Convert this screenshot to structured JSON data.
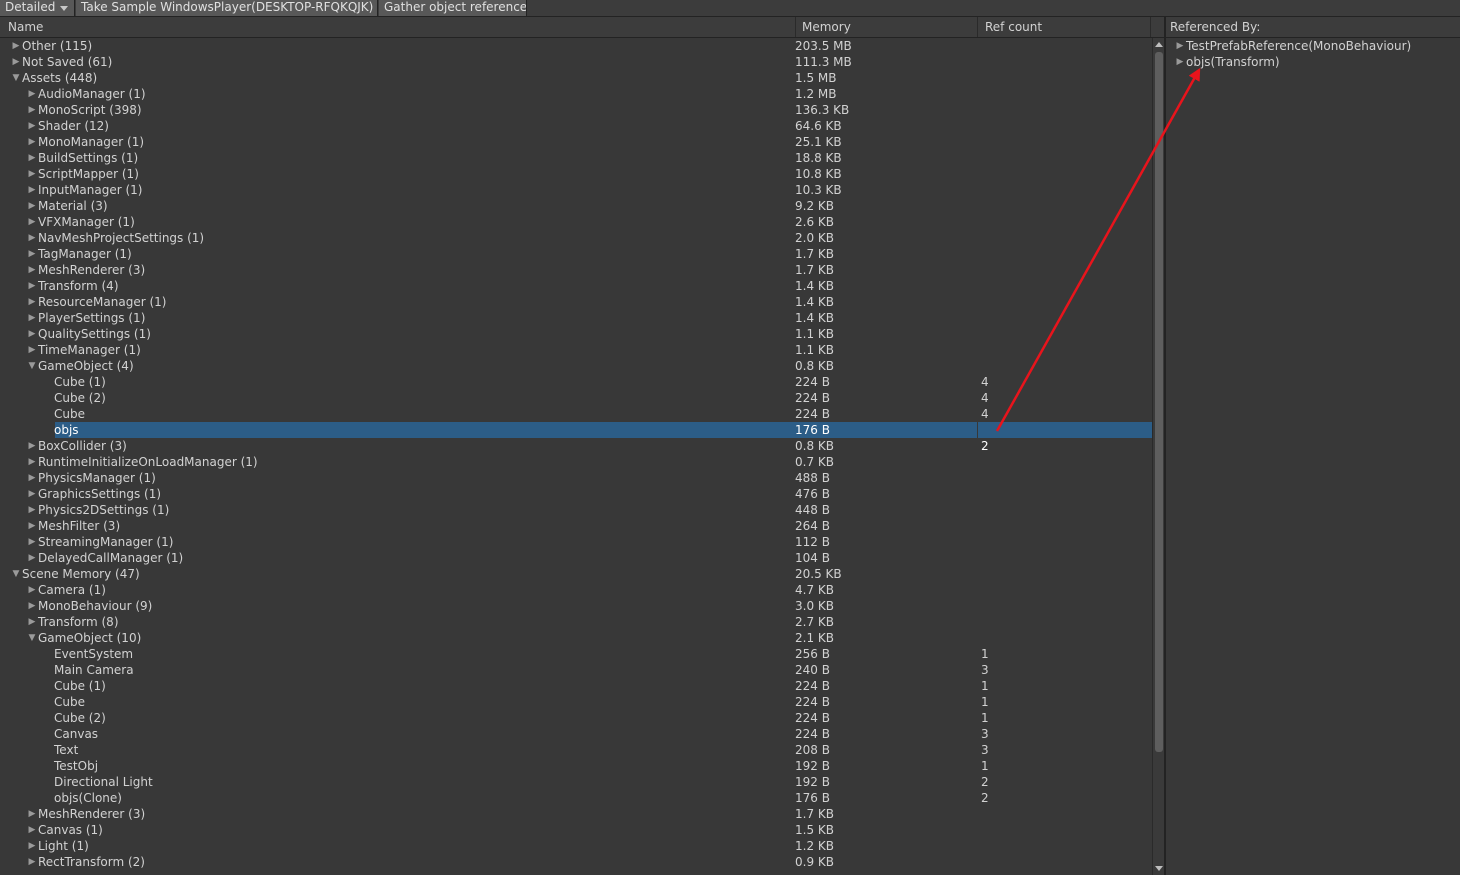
{
  "toolbar": {
    "view_mode": "Detailed",
    "take_sample": "Take Sample WindowsPlayer(DESKTOP-RFQKQJK)",
    "gather": "Gather object references"
  },
  "columns": {
    "name": "Name",
    "memory": "Memory",
    "ref_count": "Ref count"
  },
  "rows": [
    {
      "label": "Other (115)",
      "mem": "203.5 MB",
      "ref": "",
      "depth": 0,
      "state": "collapsed"
    },
    {
      "label": "Not Saved (61)",
      "mem": "111.3 MB",
      "ref": "",
      "depth": 0,
      "state": "collapsed"
    },
    {
      "label": "Assets (448)",
      "mem": "1.5 MB",
      "ref": "",
      "depth": 0,
      "state": "expanded"
    },
    {
      "label": "AudioManager (1)",
      "mem": "1.2 MB",
      "ref": "",
      "depth": 1,
      "state": "collapsed"
    },
    {
      "label": "MonoScript (398)",
      "mem": "136.3 KB",
      "ref": "",
      "depth": 1,
      "state": "collapsed"
    },
    {
      "label": "Shader (12)",
      "mem": "64.6 KB",
      "ref": "",
      "depth": 1,
      "state": "collapsed"
    },
    {
      "label": "MonoManager (1)",
      "mem": "25.1 KB",
      "ref": "",
      "depth": 1,
      "state": "collapsed"
    },
    {
      "label": "BuildSettings (1)",
      "mem": "18.8 KB",
      "ref": "",
      "depth": 1,
      "state": "collapsed"
    },
    {
      "label": "ScriptMapper (1)",
      "mem": "10.8 KB",
      "ref": "",
      "depth": 1,
      "state": "collapsed"
    },
    {
      "label": "InputManager (1)",
      "mem": "10.3 KB",
      "ref": "",
      "depth": 1,
      "state": "collapsed"
    },
    {
      "label": "Material (3)",
      "mem": "9.2 KB",
      "ref": "",
      "depth": 1,
      "state": "collapsed"
    },
    {
      "label": "VFXManager (1)",
      "mem": "2.6 KB",
      "ref": "",
      "depth": 1,
      "state": "collapsed"
    },
    {
      "label": "NavMeshProjectSettings (1)",
      "mem": "2.0 KB",
      "ref": "",
      "depth": 1,
      "state": "collapsed"
    },
    {
      "label": "TagManager (1)",
      "mem": "1.7 KB",
      "ref": "",
      "depth": 1,
      "state": "collapsed"
    },
    {
      "label": "MeshRenderer (3)",
      "mem": "1.7 KB",
      "ref": "",
      "depth": 1,
      "state": "collapsed"
    },
    {
      "label": "Transform (4)",
      "mem": "1.4 KB",
      "ref": "",
      "depth": 1,
      "state": "collapsed"
    },
    {
      "label": "ResourceManager (1)",
      "mem": "1.4 KB",
      "ref": "",
      "depth": 1,
      "state": "collapsed"
    },
    {
      "label": "PlayerSettings (1)",
      "mem": "1.4 KB",
      "ref": "",
      "depth": 1,
      "state": "collapsed"
    },
    {
      "label": "QualitySettings (1)",
      "mem": "1.1 KB",
      "ref": "",
      "depth": 1,
      "state": "collapsed"
    },
    {
      "label": "TimeManager (1)",
      "mem": "1.1 KB",
      "ref": "",
      "depth": 1,
      "state": "collapsed"
    },
    {
      "label": "GameObject (4)",
      "mem": "0.8 KB",
      "ref": "",
      "depth": 1,
      "state": "expanded"
    },
    {
      "label": "Cube (1)",
      "mem": "224 B",
      "ref": "4",
      "depth": 2,
      "state": "leaf"
    },
    {
      "label": "Cube (2)",
      "mem": "224 B",
      "ref": "4",
      "depth": 2,
      "state": "leaf"
    },
    {
      "label": "Cube",
      "mem": "224 B",
      "ref": "4",
      "depth": 2,
      "state": "leaf"
    },
    {
      "label": "objs",
      "mem": "176 B",
      "ref": "2",
      "depth": 2,
      "state": "leaf",
      "selected": true
    },
    {
      "label": "BoxCollider (3)",
      "mem": "0.8 KB",
      "ref": "",
      "depth": 1,
      "state": "collapsed"
    },
    {
      "label": "RuntimeInitializeOnLoadManager (1)",
      "mem": "0.7 KB",
      "ref": "",
      "depth": 1,
      "state": "collapsed"
    },
    {
      "label": "PhysicsManager (1)",
      "mem": "488 B",
      "ref": "",
      "depth": 1,
      "state": "collapsed"
    },
    {
      "label": "GraphicsSettings (1)",
      "mem": "476 B",
      "ref": "",
      "depth": 1,
      "state": "collapsed"
    },
    {
      "label": "Physics2DSettings (1)",
      "mem": "448 B",
      "ref": "",
      "depth": 1,
      "state": "collapsed"
    },
    {
      "label": "MeshFilter (3)",
      "mem": "264 B",
      "ref": "",
      "depth": 1,
      "state": "collapsed"
    },
    {
      "label": "StreamingManager (1)",
      "mem": "112 B",
      "ref": "",
      "depth": 1,
      "state": "collapsed"
    },
    {
      "label": "DelayedCallManager (1)",
      "mem": "104 B",
      "ref": "",
      "depth": 1,
      "state": "collapsed"
    },
    {
      "label": "Scene Memory (47)",
      "mem": "20.5 KB",
      "ref": "",
      "depth": 0,
      "state": "expanded"
    },
    {
      "label": "Camera (1)",
      "mem": "4.7 KB",
      "ref": "",
      "depth": 1,
      "state": "collapsed"
    },
    {
      "label": "MonoBehaviour (9)",
      "mem": "3.0 KB",
      "ref": "",
      "depth": 1,
      "state": "collapsed"
    },
    {
      "label": "Transform (8)",
      "mem": "2.7 KB",
      "ref": "",
      "depth": 1,
      "state": "collapsed"
    },
    {
      "label": "GameObject (10)",
      "mem": "2.1 KB",
      "ref": "",
      "depth": 1,
      "state": "expanded"
    },
    {
      "label": "EventSystem",
      "mem": "256 B",
      "ref": "1",
      "depth": 2,
      "state": "leaf"
    },
    {
      "label": "Main Camera",
      "mem": "240 B",
      "ref": "3",
      "depth": 2,
      "state": "leaf"
    },
    {
      "label": "Cube (1)",
      "mem": "224 B",
      "ref": "1",
      "depth": 2,
      "state": "leaf"
    },
    {
      "label": "Cube",
      "mem": "224 B",
      "ref": "1",
      "depth": 2,
      "state": "leaf"
    },
    {
      "label": "Cube (2)",
      "mem": "224 B",
      "ref": "1",
      "depth": 2,
      "state": "leaf"
    },
    {
      "label": "Canvas",
      "mem": "224 B",
      "ref": "3",
      "depth": 2,
      "state": "leaf"
    },
    {
      "label": "Text",
      "mem": "208 B",
      "ref": "3",
      "depth": 2,
      "state": "leaf"
    },
    {
      "label": "TestObj",
      "mem": "192 B",
      "ref": "1",
      "depth": 2,
      "state": "leaf"
    },
    {
      "label": "Directional Light",
      "mem": "192 B",
      "ref": "2",
      "depth": 2,
      "state": "leaf"
    },
    {
      "label": "objs(Clone)",
      "mem": "176 B",
      "ref": "2",
      "depth": 2,
      "state": "leaf"
    },
    {
      "label": "MeshRenderer (3)",
      "mem": "1.7 KB",
      "ref": "",
      "depth": 1,
      "state": "collapsed"
    },
    {
      "label": "Canvas (1)",
      "mem": "1.5 KB",
      "ref": "",
      "depth": 1,
      "state": "collapsed"
    },
    {
      "label": "Light (1)",
      "mem": "1.2 KB",
      "ref": "",
      "depth": 1,
      "state": "collapsed"
    },
    {
      "label": "RectTransform (2)",
      "mem": "0.9 KB",
      "ref": "",
      "depth": 1,
      "state": "collapsed"
    }
  ],
  "referenced_by": {
    "title": "Referenced By:",
    "items": [
      {
        "label": "TestPrefabReference(MonoBehaviour)"
      },
      {
        "label": "objs(Transform)"
      }
    ]
  },
  "colors": {
    "selection": "#2c5d87",
    "arrow": "#e8141c"
  }
}
